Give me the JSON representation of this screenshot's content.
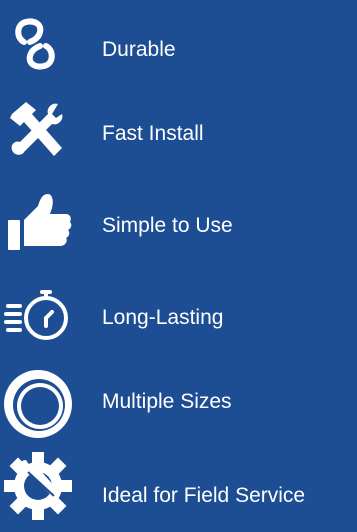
{
  "colors": {
    "background": "#1d4e93",
    "foreground": "#ffffff"
  },
  "features": [
    {
      "icon": "chain-link-icon",
      "label": "Durable"
    },
    {
      "icon": "hammer-wrench-icon",
      "label": "Fast Install"
    },
    {
      "icon": "thumbs-up-icon",
      "label": "Simple to Use"
    },
    {
      "icon": "stopwatch-icon",
      "label": "Long-Lasting"
    },
    {
      "icon": "concentric-rings-icon",
      "label": "Multiple Sizes"
    },
    {
      "icon": "gear-wrench-icon",
      "label": "Ideal for Field Service"
    }
  ]
}
